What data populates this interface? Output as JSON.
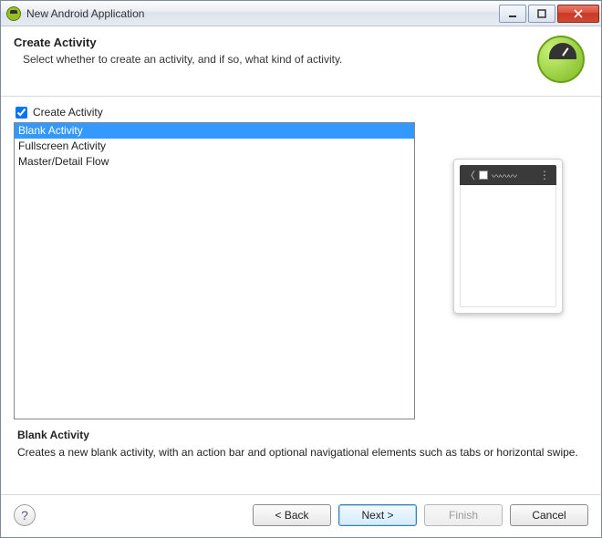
{
  "window": {
    "title": "New Android Application"
  },
  "banner": {
    "title": "Create Activity",
    "description": "Select whether to create an activity, and if so, what kind of activity."
  },
  "checkbox": {
    "label": "Create Activity",
    "checked": true
  },
  "templates": {
    "items": [
      {
        "label": "Blank Activity",
        "selected": true
      },
      {
        "label": "Fullscreen Activity",
        "selected": false
      },
      {
        "label": "Master/Detail Flow",
        "selected": false
      }
    ]
  },
  "description": {
    "title": "Blank Activity",
    "text": "Creates a new blank activity, with an action bar and optional navigational elements such as tabs or horizontal swipe."
  },
  "buttons": {
    "back": "< Back",
    "next": "Next >",
    "finish": "Finish",
    "cancel": "Cancel"
  }
}
